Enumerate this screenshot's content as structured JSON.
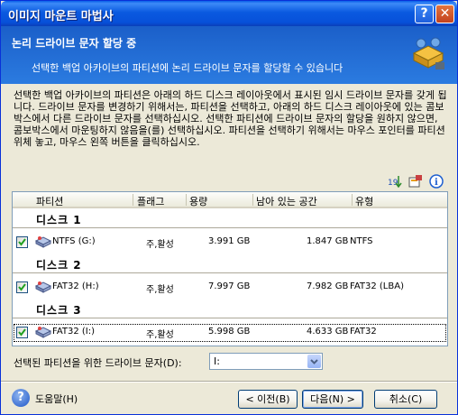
{
  "window": {
    "title": "이미지 마운트 마법사",
    "help_btn": "?",
    "close_btn": "✕"
  },
  "header": {
    "title": "논리 드라이브 문자 할당 중",
    "subtitle": "선택한 백업 아카이브의 파티션에 논리 드라이브 문자를 할당할 수 있습니다"
  },
  "description": "선택한 백업 아카이브의 파티션은 아래의 하드 디스크 레이아웃에서 표시된 임시 드라이브 문자를 갖게 됩니다. 드라이브 문자를 변경하기 위해서는, 파티션을 선택하고, 아래의 하드 디스크 레이아웃에 있는 콤보박스에서 다른 드라이브 문자를 선택하십시오. 선택한 파티션에 드라이브 문자의 할당을 원하지 않으면, 콤보박스에서 마운팅하지 않음을(를) 선택하십시오. 파티션을 선택하기 위해서는 마우스 포인터를 파티션 위체 놓고, 마우스 왼쪽 버튼을 클릭하십시오.",
  "toolbar_icons": [
    "sort-icon",
    "properties-icon",
    "info-icon"
  ],
  "columns": [
    "파티션",
    "플래그",
    "용량",
    "남아 있는 공간",
    "유형"
  ],
  "disks": [
    {
      "label": "디스크 1",
      "partition": {
        "name": "NTFS (G:)",
        "flags": "주,활성",
        "capacity": "3.991 GB",
        "free": "1.847 GB",
        "type": "NTFS",
        "checked": true
      }
    },
    {
      "label": "디스크 2",
      "partition": {
        "name": "FAT32 (H:)",
        "flags": "주,활성",
        "capacity": "7.997 GB",
        "free": "7.982 GB",
        "type": "FAT32 (LBA)",
        "checked": true
      }
    },
    {
      "label": "디스크 3",
      "partition": {
        "name": "FAT32 (I:)",
        "flags": "주,활성",
        "capacity": "5.998 GB",
        "free": "4.633 GB",
        "type": "FAT32",
        "checked": true
      }
    }
  ],
  "drive_select": {
    "label": "선택된 파티션을 위한 드라이브 문자(D):",
    "value": "I:"
  },
  "buttons": {
    "help": "도움말(H)",
    "back": "< 이전(B)",
    "next": "다음(N) >",
    "cancel": "취소(C)"
  },
  "colors": {
    "title_bar": "#0750D9",
    "header_bg": "#2B7BE0",
    "dialog_bg": "#ECE9D8",
    "check": "#21A121"
  }
}
